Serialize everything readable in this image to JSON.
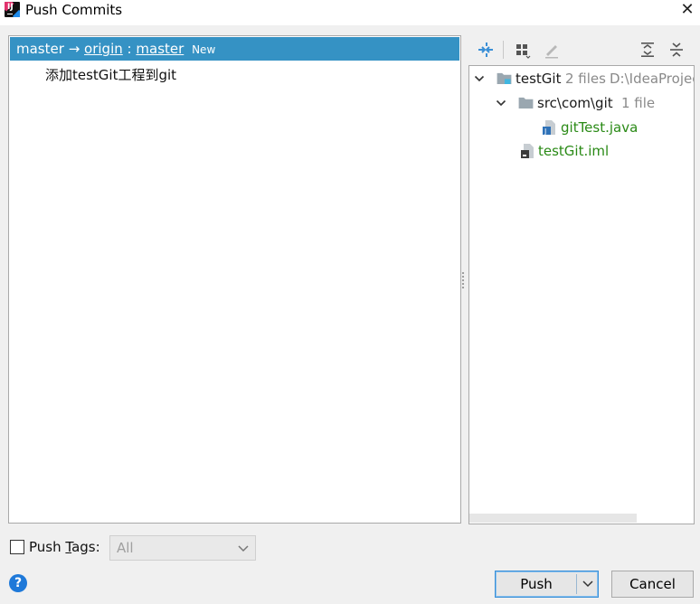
{
  "window": {
    "title": "Push Commits",
    "close_glyph": "✕"
  },
  "branches": {
    "source": "master",
    "arrow": "→",
    "remote": "origin",
    "separator": ":",
    "target": "master",
    "badge": "New"
  },
  "commits": [
    {
      "message": "添加testGit工程到git"
    }
  ],
  "toolbar": {
    "icons": [
      "collapse-diff-icon",
      "group-by-icon",
      "edit-icon",
      "expand-all-icon",
      "collapse-all-icon"
    ]
  },
  "file_tree": {
    "root": {
      "name": "testGit",
      "count": "2 files",
      "path": "D:\\IdeaProjec"
    },
    "folder": {
      "name": "src\\com\\git",
      "count": "1 file"
    },
    "files": [
      {
        "name": "gitTest.java",
        "color": "#2a8a16"
      },
      {
        "name": "testGit.iml",
        "color": "#2a8a16"
      }
    ]
  },
  "tags": {
    "checkbox_checked": false,
    "label_prefix": "Push ",
    "label_mnemonic": "T",
    "label_suffix": "ags:",
    "select_value": "All"
  },
  "footer": {
    "help_glyph": "?",
    "push_label": "Push",
    "cancel_label": "Cancel"
  },
  "colors": {
    "selection": "#3592c4",
    "added_file": "#2a8a16",
    "help_blue": "#1e79d9"
  }
}
